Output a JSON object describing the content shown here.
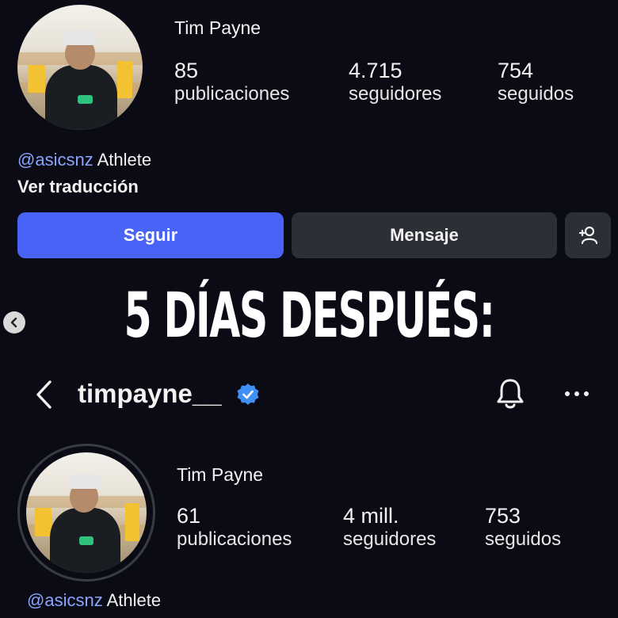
{
  "top_profile": {
    "name": "Tim Payne",
    "stats": [
      {
        "value": "85",
        "label": "publicaciones"
      },
      {
        "value": "4.715",
        "label": "seguidores"
      },
      {
        "value": "754",
        "label": "seguidos"
      }
    ],
    "bio_mention": "@asicsnz",
    "bio_text": "Athlete",
    "translate_link": "Ver traducción",
    "buttons": {
      "follow": "Seguir",
      "message": "Mensaje"
    }
  },
  "headline": "5 DÍAS DESPUÉS:",
  "bottom_profile": {
    "username": "timpayne__",
    "name": "Tim Payne",
    "stats": [
      {
        "value": "61",
        "label": "publicaciones"
      },
      {
        "value": "4 mill.",
        "label": "seguidores"
      },
      {
        "value": "753",
        "label": "seguidos"
      }
    ],
    "bio_mention": "@asicsnz",
    "bio_text": "Athlete"
  },
  "icons": {
    "add_person": "add-person-icon",
    "back": "back-arrow-icon",
    "verified": "verified-badge-icon",
    "bell": "bell-icon",
    "more": "more-icon",
    "carousel_prev": "carousel-prev-icon"
  },
  "colors": {
    "background": "#0a0b14",
    "follow_button": "#4a63f7",
    "message_button": "#2c2f36",
    "mention": "#8ba4ff",
    "verified": "#3f8ff4"
  }
}
